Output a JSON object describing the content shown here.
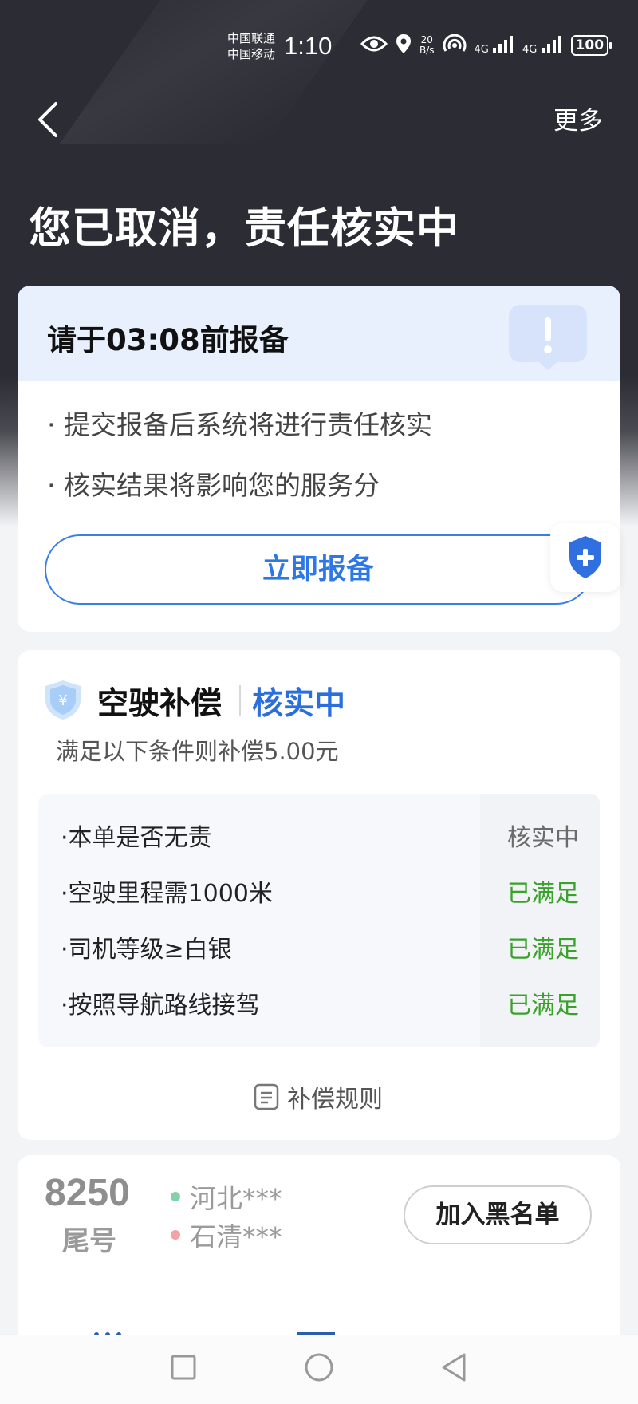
{
  "status_bar": {
    "carrier1": "中国联通",
    "carrier2": "中国移动",
    "time": "1:10",
    "net_speed_value": "20",
    "net_speed_unit": "B/s",
    "signal1": "4G",
    "signal2": "4G",
    "battery": "100"
  },
  "header": {
    "more_label": "更多",
    "title": "您已取消，责任核实中"
  },
  "report_card": {
    "title": "请于03:08前报备",
    "bullets": [
      "· 提交报备后系统将进行责任核实",
      "· 核实结果将影响您的服务分"
    ],
    "button_label": "立即报备"
  },
  "compensation": {
    "title": "空驶补偿",
    "status": "核实中",
    "subtitle": "满足以下条件则补偿5.00元",
    "conditions": [
      {
        "label": "·本单是否无责",
        "value": "核实中",
        "state": "pending"
      },
      {
        "label": "·空驶里程需1000米",
        "value": "已满足",
        "state": "met"
      },
      {
        "label": "·司机等级≥白银",
        "value": "已满足",
        "state": "met"
      },
      {
        "label": "·按照导航路线接驾",
        "value": "已满足",
        "state": "met"
      }
    ],
    "rules_label": "补偿规则"
  },
  "passenger": {
    "phone_tail": "8250",
    "tail_label": "尾号",
    "from": "河北***",
    "to": "石清***",
    "blacklist_label": "加入黑名单"
  },
  "colors": {
    "accent": "#2e78e6",
    "met_green": "#3aa12a",
    "dark_header": "#2c2c35",
    "from_dot": "#7fd3a6",
    "to_dot": "#f2a3a3"
  }
}
